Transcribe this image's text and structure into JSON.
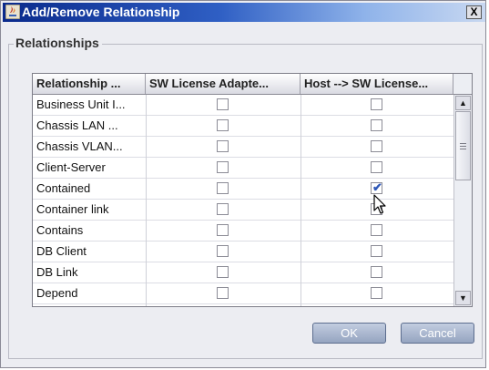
{
  "window": {
    "title": "Add/Remove Relationship",
    "close_label": "X"
  },
  "group": {
    "title": "Relationships"
  },
  "table": {
    "columns": [
      "Relationship ...",
      "SW License Adapte...",
      "Host --> SW License..."
    ],
    "rows": [
      {
        "name": "Business Unit I...",
        "col1": false,
        "col2": false
      },
      {
        "name": "Chassis LAN ...",
        "col1": false,
        "col2": false
      },
      {
        "name": "Chassis VLAN...",
        "col1": false,
        "col2": false
      },
      {
        "name": "Client-Server",
        "col1": false,
        "col2": false
      },
      {
        "name": "Contained",
        "col1": false,
        "col2": true
      },
      {
        "name": "Container link",
        "col1": false,
        "col2": false
      },
      {
        "name": "Contains",
        "col1": false,
        "col2": false
      },
      {
        "name": "DB Client",
        "col1": false,
        "col2": false
      },
      {
        "name": "DB Link",
        "col1": false,
        "col2": false
      },
      {
        "name": "Depend",
        "col1": false,
        "col2": false
      }
    ]
  },
  "buttons": {
    "ok": "OK",
    "cancel": "Cancel"
  },
  "colors": {
    "title_start": "#0a2a8c",
    "title_end": "#c8d8f1",
    "check": "#2f58b8",
    "button": "#95a4c0"
  }
}
